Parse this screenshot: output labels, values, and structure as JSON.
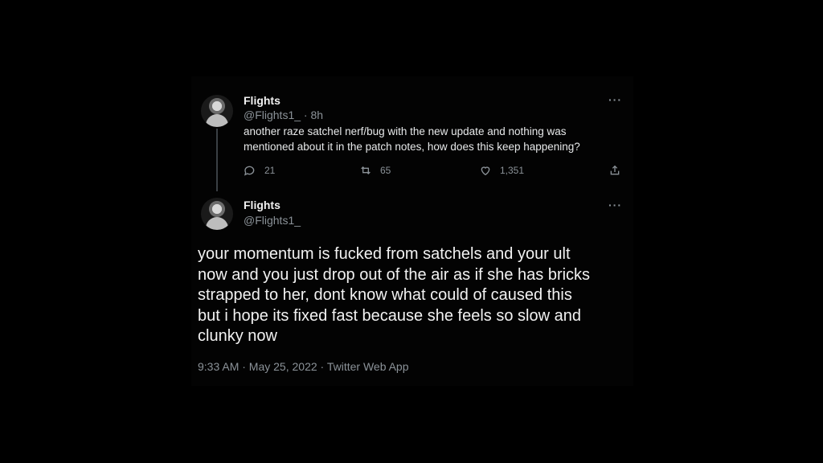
{
  "parent_tweet": {
    "name": "Flights",
    "handle_time": "@Flights1_ · 8h",
    "text_line1": "another raze satchel nerf/bug with the new update and nothing was",
    "text_line2": "mentioned about it in the patch notes, how does this keep happening?",
    "replies": "21",
    "retweets": "65",
    "likes": "1,351",
    "more": "···"
  },
  "main_tweet": {
    "name": "Flights",
    "handle": "@Flights1_",
    "more": "···",
    "text_line1": "your momentum is fucked from satchels and your ult",
    "text_line2": "now and you just drop out of the air as if she has bricks",
    "text_line3": "strapped to her, dont know what could of caused this",
    "text_line4": "but i hope its fixed fast because she feels so slow and",
    "text_line5": "clunky now",
    "meta": "9:33 AM · May 25, 2022 · Twitter Web App"
  },
  "icons": {
    "reply": "reply-icon",
    "retweet": "retweet-icon",
    "like": "heart-icon",
    "share": "share-icon"
  },
  "colors": {
    "background": "#000000",
    "text": "#e7e9ea",
    "muted": "#8b9298"
  }
}
